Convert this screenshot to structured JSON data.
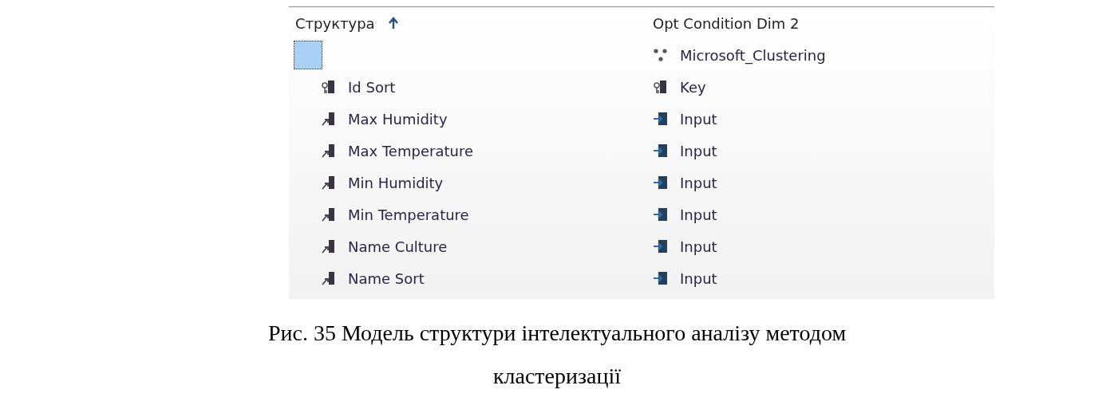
{
  "grid": {
    "columns": [
      {
        "label": "Структура"
      },
      {
        "label": "Opt Condition Dim 2"
      }
    ],
    "rows": [
      {
        "column": {
          "kind": "root"
        },
        "usage": {
          "kind": "algorithm",
          "text": "Microsoft_Clustering"
        }
      },
      {
        "column": {
          "kind": "key",
          "name": "Id Sort"
        },
        "usage": {
          "kind": "key",
          "text": "Key"
        }
      },
      {
        "column": {
          "kind": "column",
          "name": "Max Humidity"
        },
        "usage": {
          "kind": "input",
          "text": "Input"
        }
      },
      {
        "column": {
          "kind": "column",
          "name": "Max Temperature"
        },
        "usage": {
          "kind": "input",
          "text": "Input"
        }
      },
      {
        "column": {
          "kind": "column",
          "name": "Min Humidity"
        },
        "usage": {
          "kind": "input",
          "text": "Input"
        }
      },
      {
        "column": {
          "kind": "column",
          "name": "Min Temperature"
        },
        "usage": {
          "kind": "input",
          "text": "Input"
        }
      },
      {
        "column": {
          "kind": "column",
          "name": "Name Culture"
        },
        "usage": {
          "kind": "input",
          "text": "Input"
        }
      },
      {
        "column": {
          "kind": "column",
          "name": "Name Sort"
        },
        "usage": {
          "kind": "input",
          "text": "Input"
        }
      }
    ]
  },
  "caption": "Рис. 35 Модель структури інтелектуального аналізу методом кластеризації"
}
